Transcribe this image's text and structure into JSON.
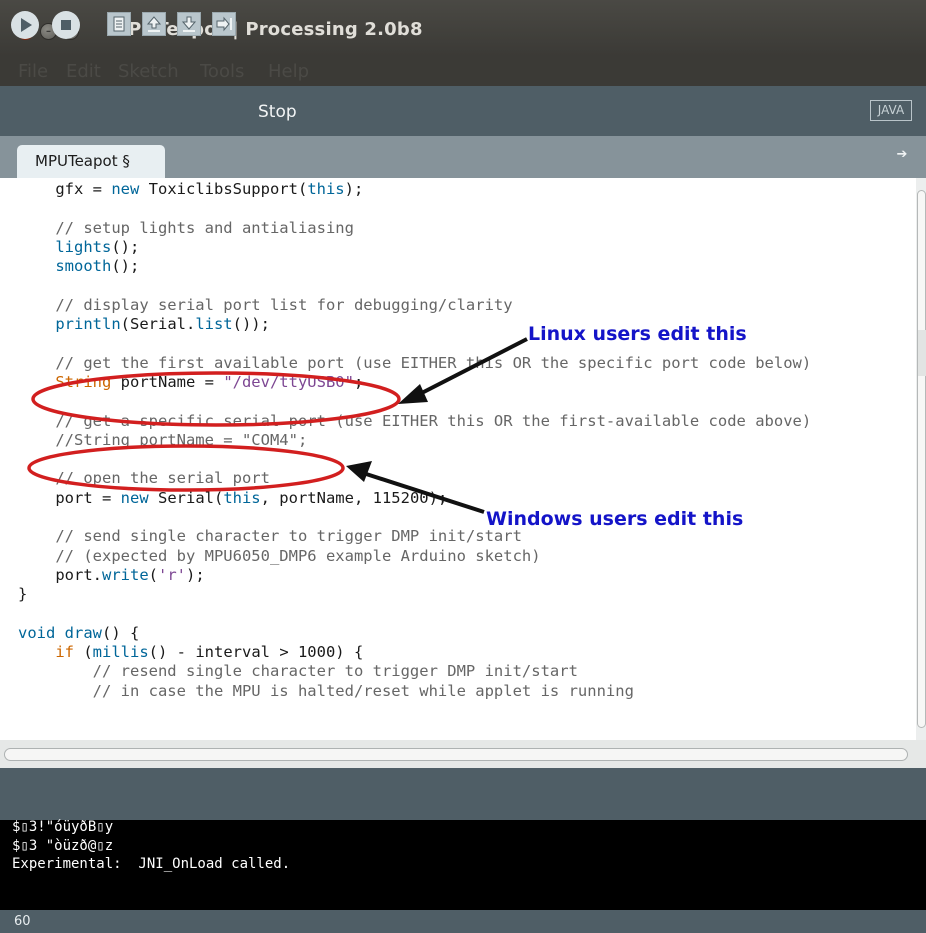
{
  "window": {
    "title": "MPUTeapot | Processing 2.0b8"
  },
  "menubar": {
    "items": [
      "File",
      "Edit",
      "Sketch",
      "Tools",
      "Help"
    ]
  },
  "toolbar": {
    "status_label": "Stop",
    "mode": "JAVA",
    "buttons": [
      "run-icon",
      "stop-icon",
      "new-icon",
      "open-icon",
      "save-icon",
      "export-icon"
    ]
  },
  "tabs": [
    {
      "label": "MPUTeapot §",
      "active": true
    }
  ],
  "editor": {
    "lines": [
      [
        {
          "t": "    gfx = ",
          "c": "tx"
        },
        {
          "t": "new",
          "c": "kw2"
        },
        {
          "t": " ToxiclibsSupport(",
          "c": "tx"
        },
        {
          "t": "this",
          "c": "kw2"
        },
        {
          "t": ");",
          "c": "tx"
        }
      ],
      [
        {
          "t": "",
          "c": "tx"
        }
      ],
      [
        {
          "t": "    // setup lights and antialiasing",
          "c": "cm"
        }
      ],
      [
        {
          "t": "    ",
          "c": "tx"
        },
        {
          "t": "lights",
          "c": "fn"
        },
        {
          "t": "();",
          "c": "tx"
        }
      ],
      [
        {
          "t": "    ",
          "c": "tx"
        },
        {
          "t": "smooth",
          "c": "fn"
        },
        {
          "t": "();",
          "c": "tx"
        }
      ],
      [
        {
          "t": "",
          "c": "tx"
        }
      ],
      [
        {
          "t": "    // display serial port list for debugging/clarity",
          "c": "cm"
        }
      ],
      [
        {
          "t": "    ",
          "c": "tx"
        },
        {
          "t": "println",
          "c": "fn"
        },
        {
          "t": "(Serial.",
          "c": "tx"
        },
        {
          "t": "list",
          "c": "fn"
        },
        {
          "t": "());",
          "c": "tx"
        }
      ],
      [
        {
          "t": "",
          "c": "tx"
        }
      ],
      [
        {
          "t": "    // get the first available port (use EITHER this OR the specific port code below)",
          "c": "cm"
        }
      ],
      [
        {
          "t": "    ",
          "c": "tx"
        },
        {
          "t": "String",
          "c": "kw"
        },
        {
          "t": " portName = ",
          "c": "tx"
        },
        {
          "t": "\"/dev/ttyUSB0\"",
          "c": "str"
        },
        {
          "t": ";",
          "c": "tx"
        }
      ],
      [
        {
          "t": "",
          "c": "tx"
        }
      ],
      [
        {
          "t": "    // get a specific serial port (use EITHER this OR the first-available code above)",
          "c": "cm"
        }
      ],
      [
        {
          "t": "    //String portName = \"COM4\";",
          "c": "cm"
        }
      ],
      [
        {
          "t": "",
          "c": "tx"
        }
      ],
      [
        {
          "t": "    // open the serial port",
          "c": "cm"
        }
      ],
      [
        {
          "t": "    port = ",
          "c": "tx"
        },
        {
          "t": "new",
          "c": "kw2"
        },
        {
          "t": " Serial(",
          "c": "tx"
        },
        {
          "t": "this",
          "c": "kw2"
        },
        {
          "t": ", portName, 115200);",
          "c": "tx"
        }
      ],
      [
        {
          "t": "",
          "c": "tx"
        }
      ],
      [
        {
          "t": "    // send single character to trigger DMP init/start",
          "c": "cm"
        }
      ],
      [
        {
          "t": "    // (expected by MPU6050_DMP6 example Arduino sketch)",
          "c": "cm"
        }
      ],
      [
        {
          "t": "    port.",
          "c": "tx"
        },
        {
          "t": "write",
          "c": "fn"
        },
        {
          "t": "(",
          "c": "tx"
        },
        {
          "t": "'r'",
          "c": "str"
        },
        {
          "t": ");",
          "c": "tx"
        }
      ],
      [
        {
          "t": "}",
          "c": "tx"
        }
      ],
      [
        {
          "t": "",
          "c": "tx"
        }
      ],
      [
        {
          "t": "void",
          "c": "kw2"
        },
        {
          "t": " ",
          "c": "tx"
        },
        {
          "t": "draw",
          "c": "fn"
        },
        {
          "t": "() {",
          "c": "tx"
        }
      ],
      [
        {
          "t": "    ",
          "c": "tx"
        },
        {
          "t": "if",
          "c": "kw"
        },
        {
          "t": " (",
          "c": "tx"
        },
        {
          "t": "millis",
          "c": "fn"
        },
        {
          "t": "() - interval > 1000) {",
          "c": "tx"
        }
      ],
      [
        {
          "t": "        // resend single character to trigger DMP init/start",
          "c": "cm"
        }
      ],
      [
        {
          "t": "        // in case the MPU is halted/reset while applet is running",
          "c": "cm"
        }
      ]
    ]
  },
  "annotations": {
    "linux": "Linux users edit this",
    "windows": "Windows users edit this",
    "color": "#1414c8",
    "ellipse_color": "#d21f1f"
  },
  "console": {
    "lines": [
      "$▯3!\"óüyðB▯y",
      "$▯3 \"òüzð@▯z",
      "Experimental:  JNI_OnLoad called."
    ]
  },
  "statusbar": {
    "line_number": "60"
  },
  "colors": {
    "toolbar": "#4f5e66",
    "tabstrip": "#86939a",
    "titlebar": "#3b3a36",
    "keyword": "#cc6600",
    "builtin": "#006699",
    "string": "#7d4793",
    "comment": "#666666"
  }
}
